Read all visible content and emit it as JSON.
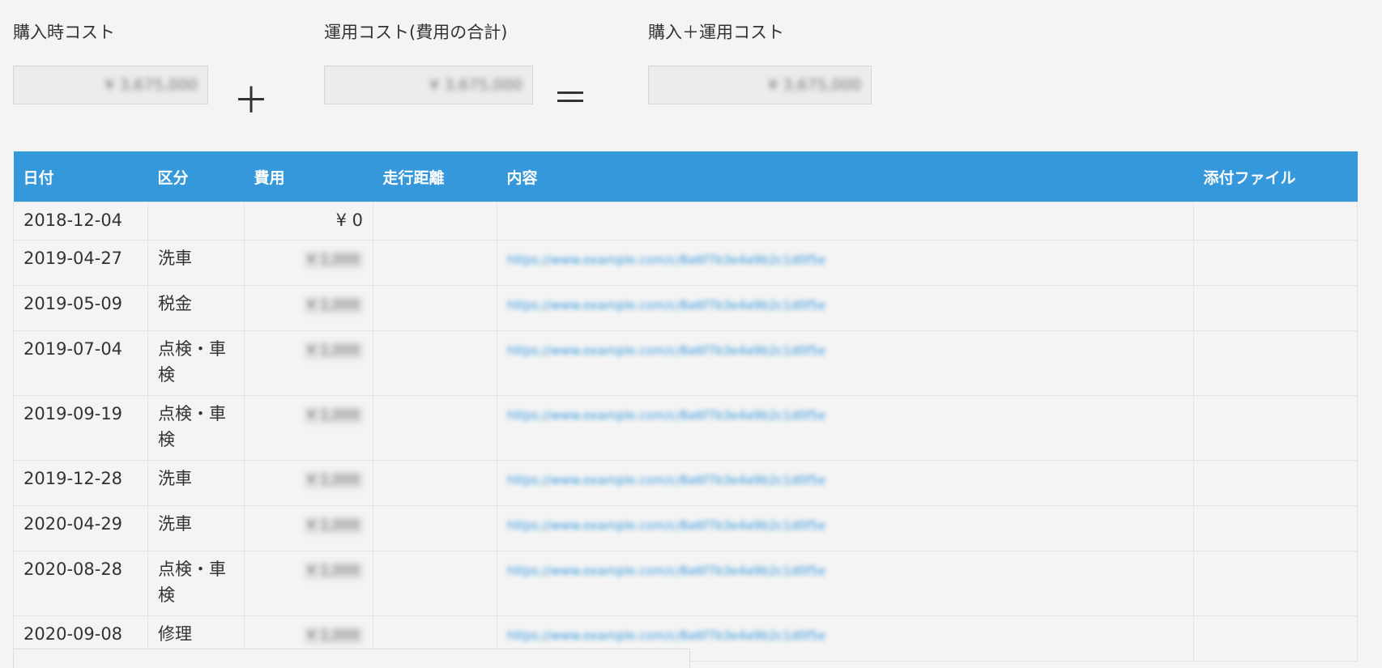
{
  "summary": {
    "purchase_label": "購入時コスト",
    "purchase_value": "¥ 3,675,000",
    "operation_label": "運用コスト(費用の合計)",
    "operation_value": "¥ 3,675,000",
    "total_label": "購入＋運用コスト",
    "total_value": "¥ 3,675,000",
    "plus_sign": "＋",
    "equals_sign": "＝"
  },
  "table": {
    "headers": {
      "date": "日付",
      "category": "区分",
      "cost": "費用",
      "distance": "走行距離",
      "content": "内容",
      "attachment": "添付ファイル"
    },
    "rows": [
      {
        "date": "2018-12-04",
        "category": "",
        "cost": "¥ 0",
        "distance": "",
        "content": "",
        "attachment": ""
      },
      {
        "date": "2019-04-27",
        "category": "洗車",
        "cost": "¥ 1,000",
        "distance": "",
        "content": "https://www.example.com/c/8a6f7b3e4a9b2c1d0f5e",
        "attachment": ""
      },
      {
        "date": "2019-05-09",
        "category": "税金",
        "cost": "¥ 1,000",
        "distance": "",
        "content": "https://www.example.com/c/8a6f7b3e4a9b2c1d0f5e",
        "attachment": ""
      },
      {
        "date": "2019-07-04",
        "category": "点検・車検",
        "cost": "¥ 1,000",
        "distance": "",
        "content": "https://www.example.com/c/8a6f7b3e4a9b2c1d0f5e",
        "attachment": ""
      },
      {
        "date": "2019-09-19",
        "category": "点検・車検",
        "cost": "¥ 1,000",
        "distance": "",
        "content": "https://www.example.com/c/8a6f7b3e4a9b2c1d0f5e",
        "attachment": ""
      },
      {
        "date": "2019-12-28",
        "category": "洗車",
        "cost": "¥ 1,000",
        "distance": "",
        "content": "https://www.example.com/c/8a6f7b3e4a9b2c1d0f5e",
        "attachment": ""
      },
      {
        "date": "2020-04-29",
        "category": "洗車",
        "cost": "¥ 1,000",
        "distance": "",
        "content": "https://www.example.com/c/8a6f7b3e4a9b2c1d0f5e",
        "attachment": ""
      },
      {
        "date": "2020-08-28",
        "category": "点検・車検",
        "cost": "¥ 1,000",
        "distance": "",
        "content": "https://www.example.com/c/8a6f7b3e4a9b2c1d0f5e",
        "attachment": ""
      },
      {
        "date": "2020-09-08",
        "category": "修理",
        "cost": "¥ 1,000",
        "distance": "",
        "content": "https://www.example.com/c/8a6f7b3e4a9b2c1d0f5e",
        "attachment": ""
      }
    ]
  },
  "colors": {
    "header_bg": "#3498db",
    "link": "#3498db",
    "page_bg": "#f4f4f4"
  }
}
